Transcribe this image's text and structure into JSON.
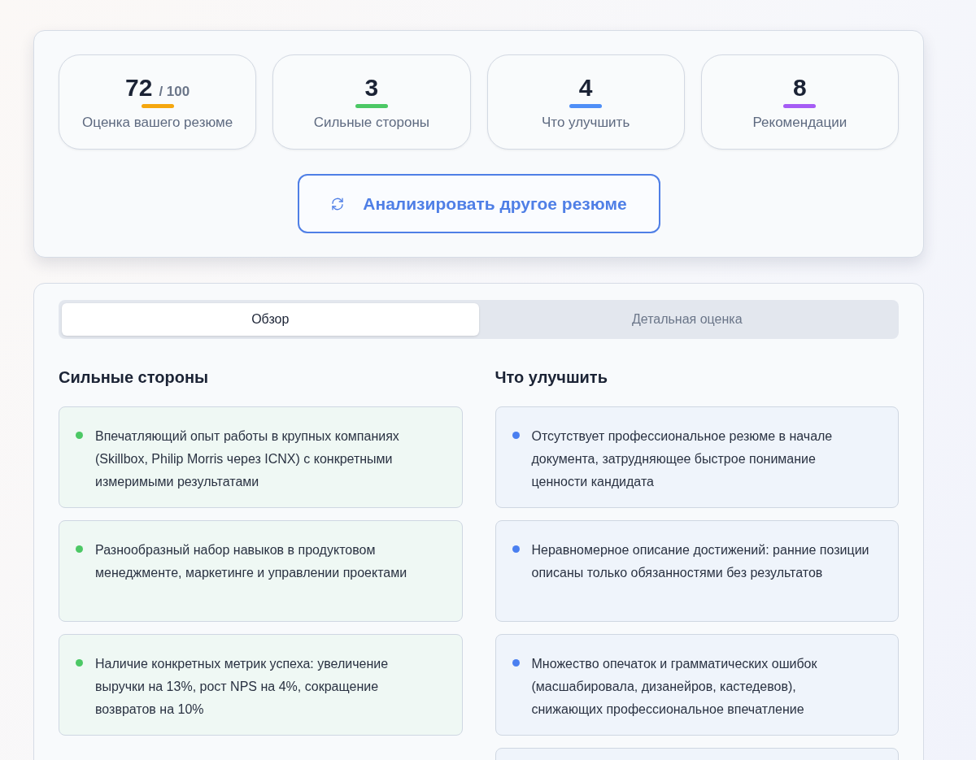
{
  "stats": [
    {
      "value": "72",
      "suffix": "/ 100",
      "label": "Оценка вашего резюме",
      "color": "#f5a70f"
    },
    {
      "value": "3",
      "label": "Сильные стороны",
      "color": "#4cc865"
    },
    {
      "value": "4",
      "label": "Что улучшить",
      "color": "#4f8ff7"
    },
    {
      "value": "8",
      "label": "Рекомендации",
      "color": "#a65cf5"
    }
  ],
  "action_button": {
    "label": "Анализировать другое резюме"
  },
  "tabs": [
    {
      "label": "Обзор",
      "selected": true
    },
    {
      "label": "Детальная оценка",
      "selected": false
    }
  ],
  "columns": [
    {
      "title": "Сильные стороны",
      "color": "#4cc865",
      "items": [
        "Впечатляющий опыт работы в крупных компаниях (Skillbox, Philip Morris через ICNX) с конкретными измеримыми результатами",
        "Разнообразный набор навыков в продуктовом менеджменте, маркетинге и управлении проектами",
        "Наличие конкретных метрик успеха: увеличение выручки на 13%, рост NPS на 4%, сокращение возвратов на 10%"
      ]
    },
    {
      "title": "Что улучшить",
      "color": "#4a7ff0",
      "items": [
        "Отсутствует профессиональное резюме в начале документа, затрудняющее быстрое понимание ценности кандидата",
        "Неравномерное описание достижений: ранние позиции описаны только обязанностями без результатов",
        "Множество опечаток и грамматических ошибок (масшабировала, дизанейров, кастедевов), снижающих профессиональное впечатление"
      ]
    }
  ]
}
